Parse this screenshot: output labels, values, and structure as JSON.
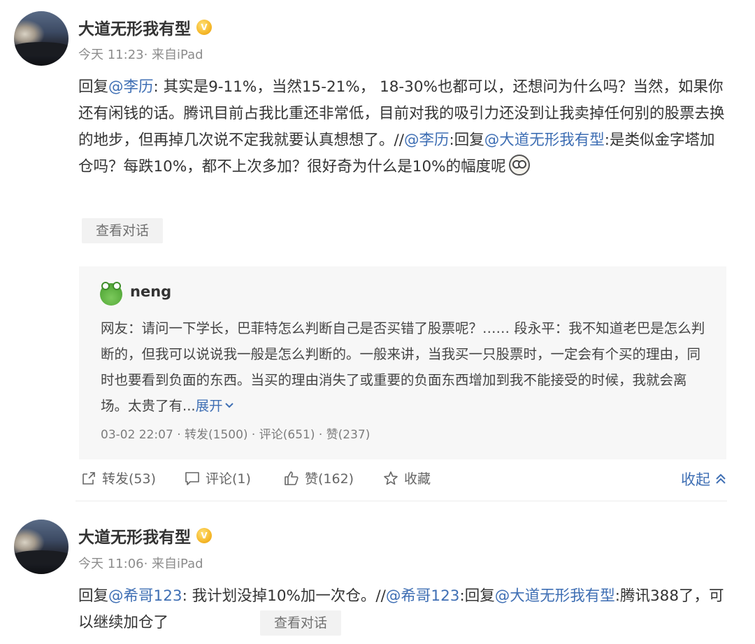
{
  "post1": {
    "author": "大道无形我有型",
    "vip_badge": "V",
    "meta": "今天 11:23· 来自iPad",
    "content": {
      "reply_prefix": "回复",
      "mention1": "@李历",
      "text1": ": 其实是9-11%，当然15-21%， 18-30%也都可以，还想问为什么吗？当然，如果你还有闲钱的话。腾讯目前占我比重还非常低，目前对我的吸引力还没到让我卖掉任何别的股票去换的地步，但再掉几次说不定我就要认真想想了。//",
      "mention2": "@李历",
      "text2": ":回复",
      "mention3": "@大道无形我有型",
      "text3": ":是类似金字塔加仓吗？每跌10%，都不上次多加？很好奇为什么是10%的幅度呢"
    },
    "view_conversation": "查看对话",
    "repost": {
      "author": "neng",
      "text": "网友：请问一下学长，巴菲特怎么判断自己是否买错了股票呢？…… 段永平：我不知道老巴是怎么判断的，但我可以说说我一般是怎么判断的。一般来讲，当我买一只股票时，一定会有个买的理由，同时也要看到负面的东西。当买的理由消失了或重要的负面东西增加到我不能接受的时候，我就会离场。太贵了有...",
      "expand": "展开",
      "meta": "03-02 22:07 · 转发(1500) · 评论(651) · 赞(237)"
    },
    "actions": {
      "forward": "转发(53)",
      "comment": "评论(1)",
      "like": "赞(162)",
      "favorite": "收藏",
      "collapse": "收起"
    }
  },
  "post2": {
    "author": "大道无形我有型",
    "vip_badge": "V",
    "meta": "今天 11:06· 来自iPad",
    "content": {
      "reply_prefix": "回复",
      "mention1": "@希哥123",
      "text1": ": 我计划没掉10%加一次仓。//",
      "mention2": "@希哥123",
      "text2": ":回复",
      "mention3": "@大道无形我有型",
      "text3": ":腾讯388了，可以继续加仓了"
    },
    "view_conversation": "查看对话"
  }
}
